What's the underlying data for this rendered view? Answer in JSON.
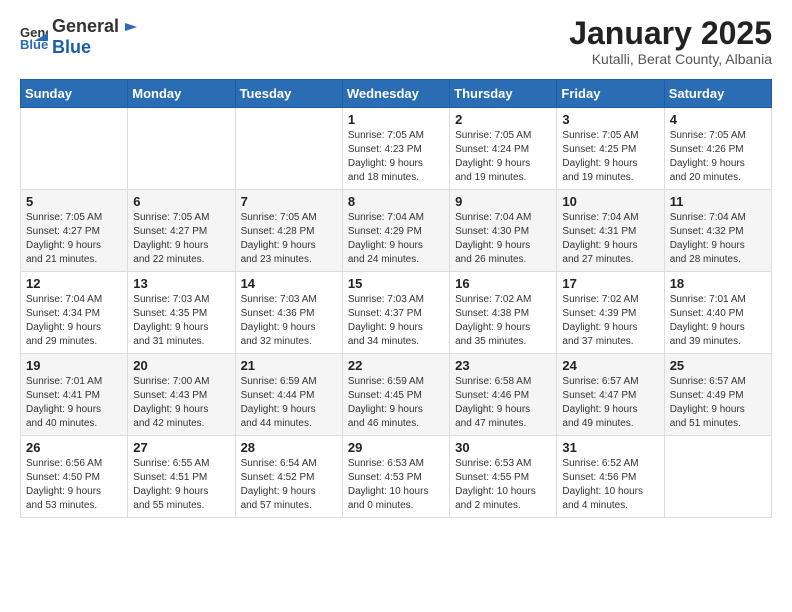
{
  "header": {
    "logo_general": "General",
    "logo_blue": "Blue",
    "title": "January 2025",
    "subtitle": "Kutalli, Berat County, Albania"
  },
  "weekdays": [
    "Sunday",
    "Monday",
    "Tuesday",
    "Wednesday",
    "Thursday",
    "Friday",
    "Saturday"
  ],
  "weeks": [
    [
      {
        "day": "",
        "info": ""
      },
      {
        "day": "",
        "info": ""
      },
      {
        "day": "",
        "info": ""
      },
      {
        "day": "1",
        "info": "Sunrise: 7:05 AM\nSunset: 4:23 PM\nDaylight: 9 hours\nand 18 minutes."
      },
      {
        "day": "2",
        "info": "Sunrise: 7:05 AM\nSunset: 4:24 PM\nDaylight: 9 hours\nand 19 minutes."
      },
      {
        "day": "3",
        "info": "Sunrise: 7:05 AM\nSunset: 4:25 PM\nDaylight: 9 hours\nand 19 minutes."
      },
      {
        "day": "4",
        "info": "Sunrise: 7:05 AM\nSunset: 4:26 PM\nDaylight: 9 hours\nand 20 minutes."
      }
    ],
    [
      {
        "day": "5",
        "info": "Sunrise: 7:05 AM\nSunset: 4:27 PM\nDaylight: 9 hours\nand 21 minutes."
      },
      {
        "day": "6",
        "info": "Sunrise: 7:05 AM\nSunset: 4:27 PM\nDaylight: 9 hours\nand 22 minutes."
      },
      {
        "day": "7",
        "info": "Sunrise: 7:05 AM\nSunset: 4:28 PM\nDaylight: 9 hours\nand 23 minutes."
      },
      {
        "day": "8",
        "info": "Sunrise: 7:04 AM\nSunset: 4:29 PM\nDaylight: 9 hours\nand 24 minutes."
      },
      {
        "day": "9",
        "info": "Sunrise: 7:04 AM\nSunset: 4:30 PM\nDaylight: 9 hours\nand 26 minutes."
      },
      {
        "day": "10",
        "info": "Sunrise: 7:04 AM\nSunset: 4:31 PM\nDaylight: 9 hours\nand 27 minutes."
      },
      {
        "day": "11",
        "info": "Sunrise: 7:04 AM\nSunset: 4:32 PM\nDaylight: 9 hours\nand 28 minutes."
      }
    ],
    [
      {
        "day": "12",
        "info": "Sunrise: 7:04 AM\nSunset: 4:34 PM\nDaylight: 9 hours\nand 29 minutes."
      },
      {
        "day": "13",
        "info": "Sunrise: 7:03 AM\nSunset: 4:35 PM\nDaylight: 9 hours\nand 31 minutes."
      },
      {
        "day": "14",
        "info": "Sunrise: 7:03 AM\nSunset: 4:36 PM\nDaylight: 9 hours\nand 32 minutes."
      },
      {
        "day": "15",
        "info": "Sunrise: 7:03 AM\nSunset: 4:37 PM\nDaylight: 9 hours\nand 34 minutes."
      },
      {
        "day": "16",
        "info": "Sunrise: 7:02 AM\nSunset: 4:38 PM\nDaylight: 9 hours\nand 35 minutes."
      },
      {
        "day": "17",
        "info": "Sunrise: 7:02 AM\nSunset: 4:39 PM\nDaylight: 9 hours\nand 37 minutes."
      },
      {
        "day": "18",
        "info": "Sunrise: 7:01 AM\nSunset: 4:40 PM\nDaylight: 9 hours\nand 39 minutes."
      }
    ],
    [
      {
        "day": "19",
        "info": "Sunrise: 7:01 AM\nSunset: 4:41 PM\nDaylight: 9 hours\nand 40 minutes."
      },
      {
        "day": "20",
        "info": "Sunrise: 7:00 AM\nSunset: 4:43 PM\nDaylight: 9 hours\nand 42 minutes."
      },
      {
        "day": "21",
        "info": "Sunrise: 6:59 AM\nSunset: 4:44 PM\nDaylight: 9 hours\nand 44 minutes."
      },
      {
        "day": "22",
        "info": "Sunrise: 6:59 AM\nSunset: 4:45 PM\nDaylight: 9 hours\nand 46 minutes."
      },
      {
        "day": "23",
        "info": "Sunrise: 6:58 AM\nSunset: 4:46 PM\nDaylight: 9 hours\nand 47 minutes."
      },
      {
        "day": "24",
        "info": "Sunrise: 6:57 AM\nSunset: 4:47 PM\nDaylight: 9 hours\nand 49 minutes."
      },
      {
        "day": "25",
        "info": "Sunrise: 6:57 AM\nSunset: 4:49 PM\nDaylight: 9 hours\nand 51 minutes."
      }
    ],
    [
      {
        "day": "26",
        "info": "Sunrise: 6:56 AM\nSunset: 4:50 PM\nDaylight: 9 hours\nand 53 minutes."
      },
      {
        "day": "27",
        "info": "Sunrise: 6:55 AM\nSunset: 4:51 PM\nDaylight: 9 hours\nand 55 minutes."
      },
      {
        "day": "28",
        "info": "Sunrise: 6:54 AM\nSunset: 4:52 PM\nDaylight: 9 hours\nand 57 minutes."
      },
      {
        "day": "29",
        "info": "Sunrise: 6:53 AM\nSunset: 4:53 PM\nDaylight: 10 hours\nand 0 minutes."
      },
      {
        "day": "30",
        "info": "Sunrise: 6:53 AM\nSunset: 4:55 PM\nDaylight: 10 hours\nand 2 minutes."
      },
      {
        "day": "31",
        "info": "Sunrise: 6:52 AM\nSunset: 4:56 PM\nDaylight: 10 hours\nand 4 minutes."
      },
      {
        "day": "",
        "info": ""
      }
    ]
  ]
}
